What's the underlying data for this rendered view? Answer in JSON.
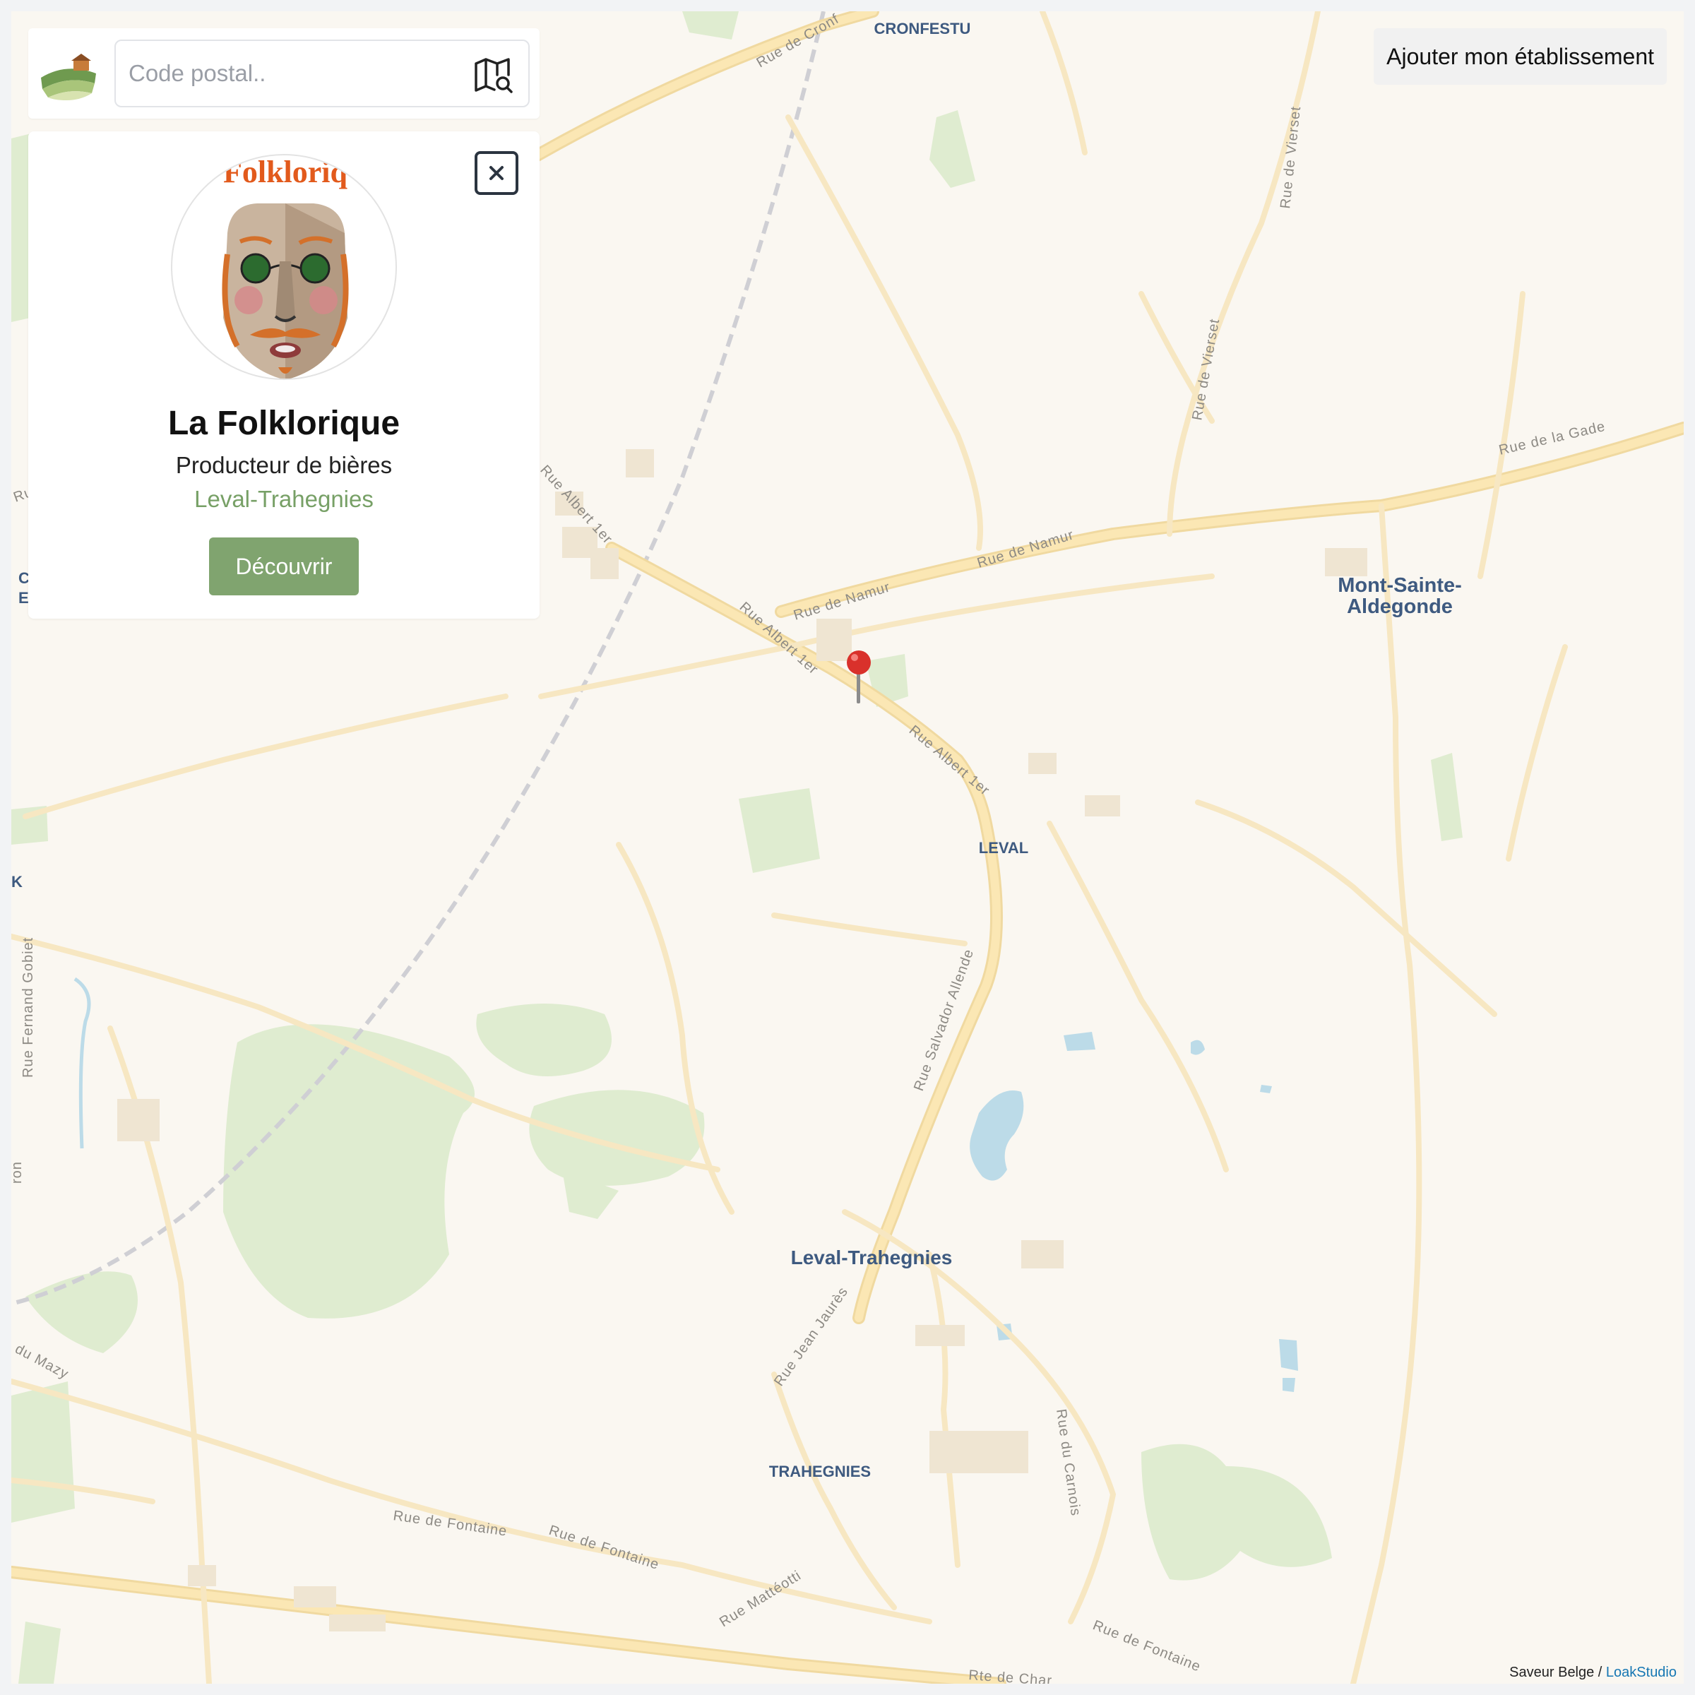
{
  "search": {
    "placeholder": "Code postal.."
  },
  "header": {
    "add_establishment_label": "Ajouter mon établissement"
  },
  "card": {
    "avatar_logo_text": "Folkloriq",
    "title": "La Folklorique",
    "category": "Producteur de bières",
    "location": "Leval-Trahegnies",
    "discover_label": "Découvrir"
  },
  "map": {
    "place_labels": {
      "cronfestu": "CRONFESTU",
      "mont_sainte_aldegonde_1": "Mont-Sainte-",
      "mont_sainte_aldegonde_2": "Aldegonde",
      "leval": "LEVAL",
      "leval_trahegnies": "Leval-Trahegnies",
      "trahegnies": "TRAHEGNIES",
      "edge_c": "C",
      "edge_e": "E",
      "edge_k": "K"
    },
    "street_labels": {
      "rue_de_cronfestu": "Rue de Cronf",
      "rue_de_vierset_1": "Rue de Vierset",
      "rue_de_vierset_2": "Rue de Vierset",
      "rue_de_la_gade": "Rue de la Gade",
      "rue_de_namur_1": "Rue de Namur",
      "rue_de_namur_2": "Rue de Namur",
      "rue_albert_1": "Rue Albert 1er",
      "rue_albert_2": "Rue Albert 1er",
      "rue_albert_3": "Rue Albert 1er",
      "rue_salvador_allende": "Rue Salvador Allende",
      "rue_fernand_gobiet": "Rue Fernand Gobiet",
      "rue_du_mazy": "du Mazy",
      "rue_jean_jaures": "Rue Jean Jaurès",
      "rue_du_carnois": "Rue du Carnois",
      "rue_de_fontaine_1": "Rue de Fontaine",
      "rue_de_fontaine_2": "Rue de Fontaine",
      "rue_de_fontaine_3": "Rue de Fontaine",
      "rue_matteotti": "Rue Mattéotti",
      "rte_de_charleroi": "Rte de Char",
      "edge_rue": "Ru",
      "edge_ron": "ron"
    },
    "colors": {
      "background": "#faf7f1",
      "road": "#fbe7b4",
      "road_outline": "#f0d9a0",
      "green": "#dfecd0",
      "water": "#bcdbe8",
      "label": "#3e5a80",
      "rail": "#cfcfd4",
      "pin": "#d9312b"
    }
  },
  "footer": {
    "attribution_text": "Saveur Belge / ",
    "attribution_link": "LoakStudio"
  }
}
